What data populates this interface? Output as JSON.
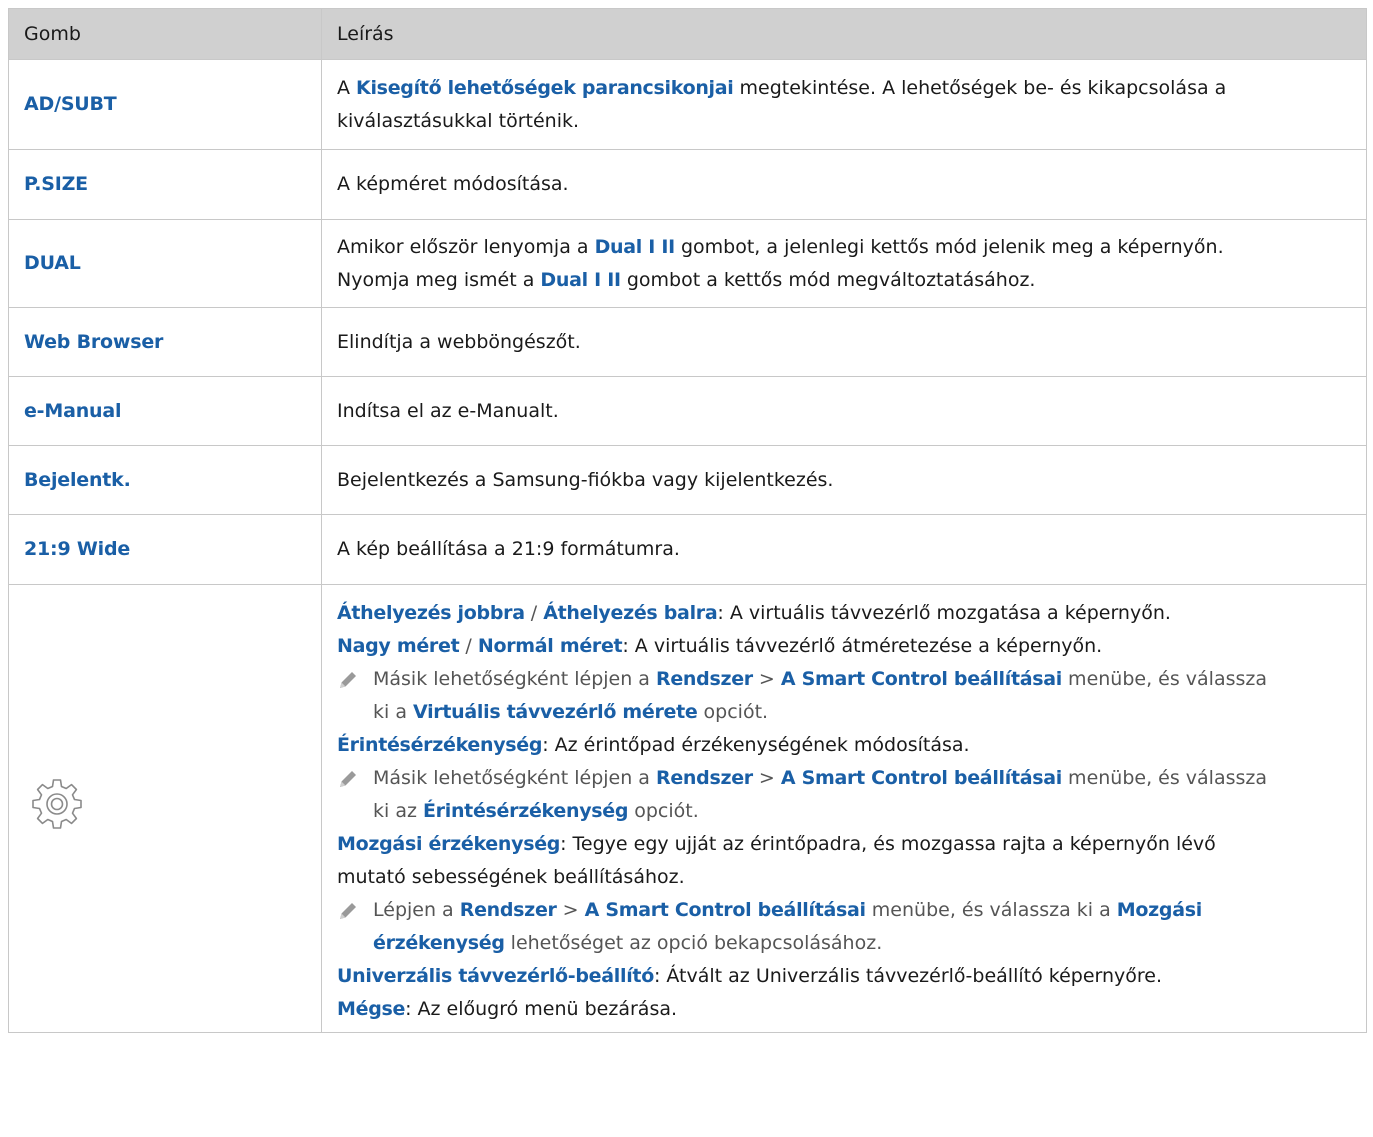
{
  "table": {
    "headers": [
      "Gomb",
      "Leírás"
    ],
    "rows": [
      {
        "key": "AD/SUBT",
        "desc": {
          "p1": "A ",
          "hl1": "Kisegítő lehetőségek parancsikonjai",
          "p2": " megtekintése. A lehetőségek be- és kikapcsolása a",
          "line2": "kiválasztásukkal történik."
        }
      },
      {
        "key": "P.SIZE",
        "desc": {
          "text": "A képméret módosítása."
        }
      },
      {
        "key": "DUAL",
        "desc": {
          "p1": "Amikor először lenyomja a ",
          "hl1": "Dual I II",
          "p2": " gombot, a jelenlegi kettős mód jelenik meg a képernyőn.",
          "p3": "Nyomja meg ismét a ",
          "hl2": "Dual I II",
          "p4": " gombot a kettős mód megváltoztatásához."
        }
      },
      {
        "key": "Web Browser",
        "desc": {
          "text": "Elindítja a webböngészőt."
        }
      },
      {
        "key": "e-Manual",
        "desc": {
          "text": "Indítsa el az e-Manualt."
        }
      },
      {
        "key": "Bejelentk.",
        "desc": {
          "text": "Bejelentkezés a Samsung-fiókba vagy kijelentkezés."
        }
      },
      {
        "key": "21:9 Wide",
        "desc": {
          "text": "A kép beállítása a 21:9 formátumra."
        }
      }
    ],
    "settings": {
      "icon": "gear-icon",
      "l1": {
        "a": "Áthelyezés jobbra",
        "sep": " / ",
        "b": "Áthelyezés balra",
        "rest": ": A virtuális távvezérlő mozgatása a képernyőn."
      },
      "l2": {
        "a": "Nagy méret",
        "sep": " / ",
        "b": "Normál méret",
        "rest": ": A virtuális távvezérlő átméretezése a képernyőn."
      },
      "n1": {
        "p1": "Másik lehetőségként lépjen a ",
        "h1": "Rendszer",
        "p2": " > ",
        "h2": "A Smart Control beállításai",
        "p3": " menübe, és válassza",
        "p4": "ki a ",
        "h3": "Virtuális távvezérlő mérete",
        "p5": " opciót."
      },
      "l3": {
        "a": "Érintésérzékenység",
        "rest": ": Az érintőpad érzékenységének módosítása."
      },
      "n2": {
        "p1": "Másik lehetőségként lépjen a ",
        "h1": "Rendszer",
        "p2": " > ",
        "h2": "A Smart Control beállításai",
        "p3": " menübe, és válassza",
        "p4": "ki az ",
        "h3": "Érintésérzékenység",
        "p5": " opciót."
      },
      "l4": {
        "a": "Mozgási érzékenység",
        "rest": ": Tegye egy ujját az érintőpadra, és mozgassa rajta a képernyőn lévő",
        "line2": "mutató sebességének beállításához."
      },
      "n3": {
        "p1": "Lépjen a ",
        "h1": "Rendszer",
        "p2": " > ",
        "h2": "A Smart Control beállításai",
        "p3": " menübe, és válassza ki a ",
        "h3": "Mozgási",
        "h4": "érzékenység",
        "p4": " lehetőséget az opció bekapcsolásához."
      },
      "l5": {
        "a": "Univerzális távvezérlő-beállító",
        "rest": ": Átvált az Univerzális távvezérlő-beállító képernyőre."
      },
      "l6": {
        "a": "Mégse",
        "rest": ": Az előugró menü bezárása."
      }
    }
  },
  "colors": {
    "accent": "#1a5fa6",
    "header_bg": "#d0d0d0",
    "border": "#c8c8c8",
    "note_text": "#555555"
  }
}
